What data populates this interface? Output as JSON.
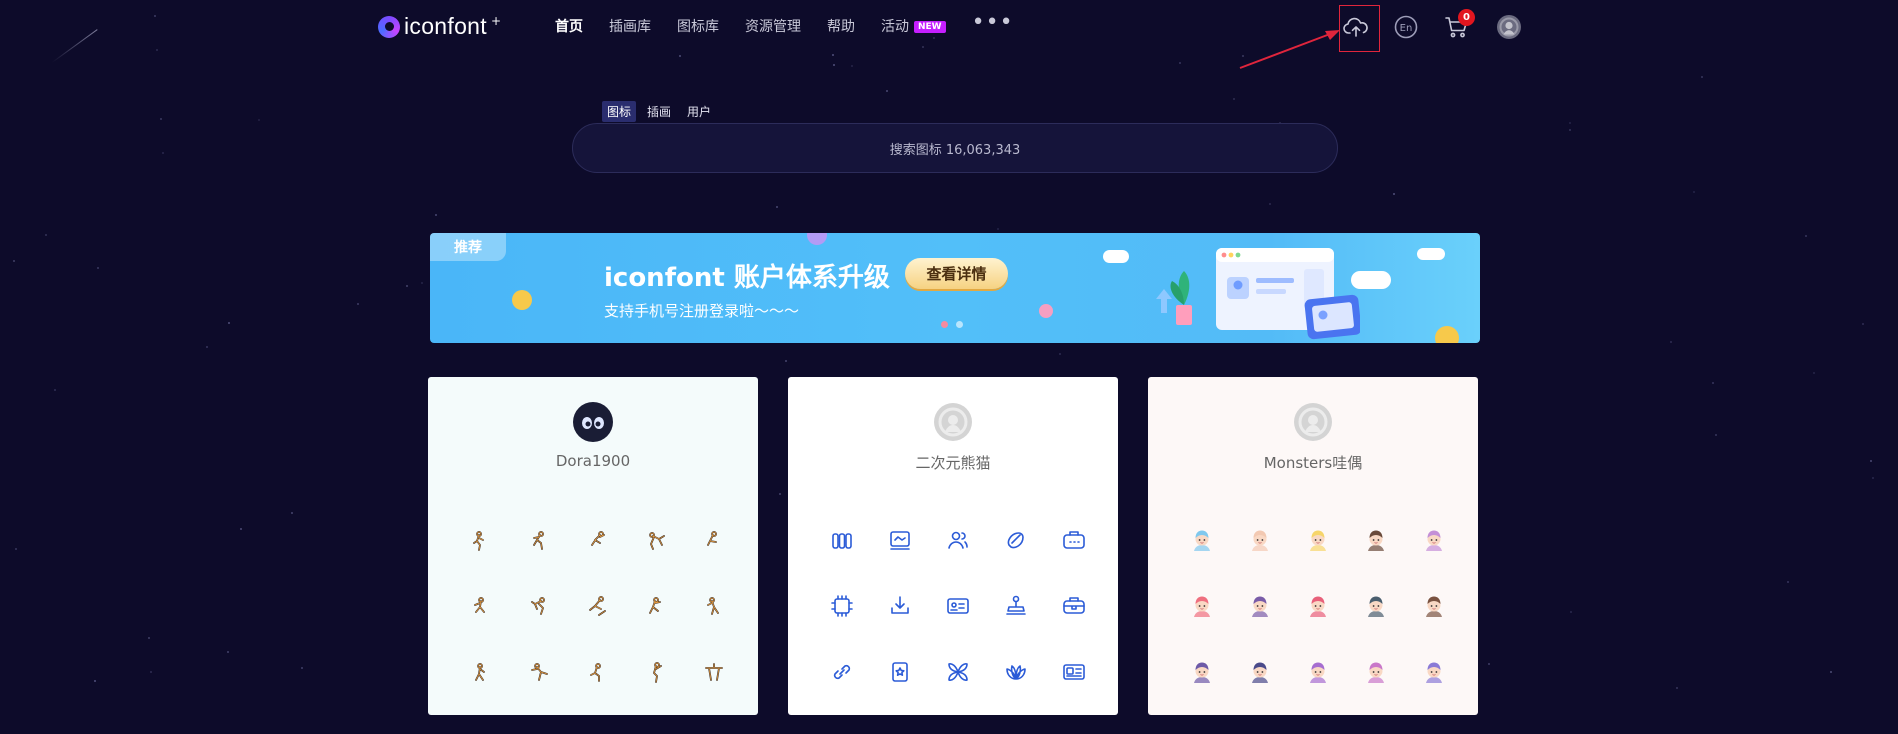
{
  "header": {
    "logo_text": "iconfont",
    "logo_sup": "+",
    "nav": [
      {
        "label": "首页",
        "active": true
      },
      {
        "label": "插画库"
      },
      {
        "label": "图标库"
      },
      {
        "label": "资源管理"
      },
      {
        "label": "帮助"
      },
      {
        "label": "活动",
        "badge": "NEW"
      }
    ],
    "more": "•••",
    "icons": [
      "upload-cloud-icon",
      "language-en-icon",
      "cart-icon",
      "user-avatar-icon"
    ],
    "lang_label": "En",
    "cart_count": "0"
  },
  "search": {
    "tabs": [
      {
        "label": "图标",
        "active": true
      },
      {
        "label": "插画"
      },
      {
        "label": "用户"
      }
    ],
    "placeholder": "搜索图标 16,063,343"
  },
  "banner": {
    "tag": "推荐",
    "title": "iconfont 账户体系升级",
    "subtitle": "支持手机号注册登录啦～～～",
    "button": "查看详情",
    "slides": 2,
    "active_slide": 0
  },
  "cards": [
    {
      "name": "Dora1900",
      "icon_style": "athlete",
      "color": "#3a2a20",
      "bg": "#f4fbfb"
    },
    {
      "name": "二次元熊猫",
      "icon_style": "line",
      "color": "#2b5bd7",
      "bg": "#ffffff"
    },
    {
      "name": "Monsters哇偶",
      "icon_style": "avatar",
      "color": "#b05bc7",
      "bg": "#fdf8f7"
    }
  ],
  "colors": {
    "background": "#0d0b2a",
    "accent": "#c51fff",
    "annotation": "#e0253c"
  }
}
